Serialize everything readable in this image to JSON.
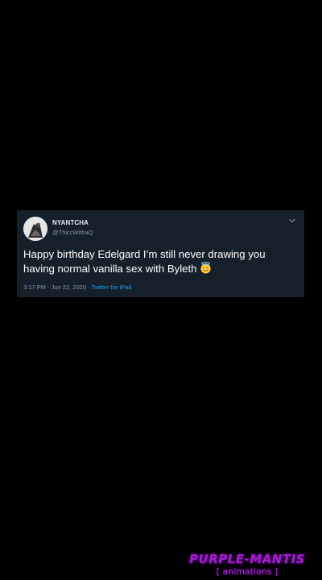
{
  "tweet": {
    "display_name": "NYANTCHA",
    "handle": "@ThiccWithaQ",
    "text": "Happy birthday Edelgard I’m still never drawing you having normal vanilla sex with Byleth",
    "timestamp": "3:17 PM · Jun 22, 2020 · ",
    "source": "Twitter for iPad",
    "emoji": "smiling-face-with-halo",
    "avatar_icon": "avatar-icon",
    "menu_icon": "chevron-down-icon"
  },
  "watermark": {
    "title": "PURPLE-MANTIS",
    "subtitle": "[ animations ]"
  },
  "colors": {
    "background": "#000000",
    "card": "#15202b",
    "text": "#ffffff",
    "muted": "#8899a6",
    "link": "#1da1f2",
    "watermark": "#a020c8"
  }
}
